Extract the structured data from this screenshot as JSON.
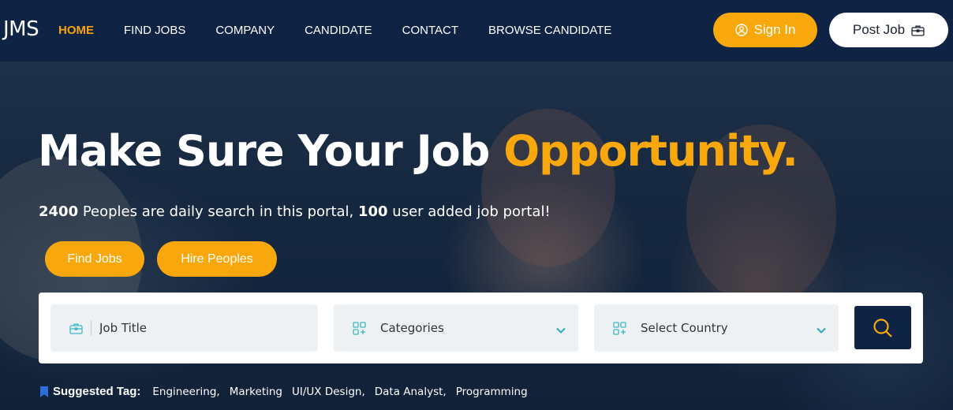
{
  "brand": {
    "logo": "JMS",
    "accent_color": "#f8a80c",
    "navy_color": "#0f2445"
  },
  "nav": {
    "links": [
      {
        "label": "HOME",
        "active": true
      },
      {
        "label": "FIND JOBS",
        "active": false
      },
      {
        "label": "COMPANY",
        "active": false
      },
      {
        "label": "CANDIDATE",
        "active": false
      },
      {
        "label": "CONTACT",
        "active": false
      },
      {
        "label": "BROWSE CANDIDATE",
        "active": false
      }
    ],
    "sign_in": {
      "label": "Sign In",
      "icon": "user-circle-icon"
    },
    "post_job": {
      "label": "Post Job",
      "icon": "briefcase-icon"
    }
  },
  "hero": {
    "title_main": "Make Sure Your Job ",
    "title_accent": "Opportunity.",
    "sub_count1": "2400",
    "sub_text1": " Peoples are daily search in this portal, ",
    "sub_count2": "100",
    "sub_text2": " user added job portal!",
    "cta_find": "Find Jobs",
    "cta_hire": "Hire Peoples"
  },
  "search": {
    "job_title_placeholder": "Job Title",
    "categories_label": "Categories",
    "country_label": "Select Country",
    "search_icon": "search-icon"
  },
  "tags": {
    "label": "Suggested Tag:",
    "items": [
      "Engineering,",
      "Marketing",
      "UI/UX Design,",
      "Data Analyst,",
      "Programming"
    ]
  }
}
